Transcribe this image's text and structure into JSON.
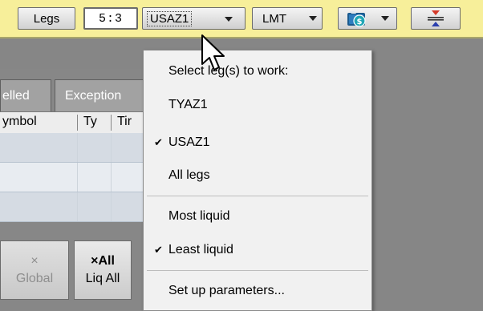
{
  "toolbar": {
    "legs_label": "Legs",
    "ratio_value": "5:3",
    "leg_combo_value": "USAZ1",
    "order_type_value": "LMT",
    "bg_color": "#f7ef9a"
  },
  "tabs": [
    {
      "label": "elled"
    },
    {
      "label": "Exception"
    }
  ],
  "grid": {
    "columns": [
      "ymbol",
      "Ty",
      "Tir"
    ],
    "row_colors": [
      "#d5dbe3",
      "#e8ecf1",
      "#d5dbe3"
    ]
  },
  "bottom_buttons": {
    "global": {
      "icon": "×",
      "label": "Global"
    },
    "liq_all": {
      "icon": "×All",
      "label": "Liq All"
    }
  },
  "menu": {
    "header": "Select leg(s) to work:",
    "items": [
      {
        "label": "TYAZ1",
        "checked": false
      },
      {
        "label": "USAZ1",
        "checked": true
      },
      {
        "label": "All legs",
        "checked": false
      },
      {
        "label": "Most liquid",
        "checked": false
      },
      {
        "label": "Least liquid",
        "checked": true
      },
      {
        "label": "Set up parameters...",
        "checked": false
      }
    ],
    "check_glyph": "✔"
  }
}
